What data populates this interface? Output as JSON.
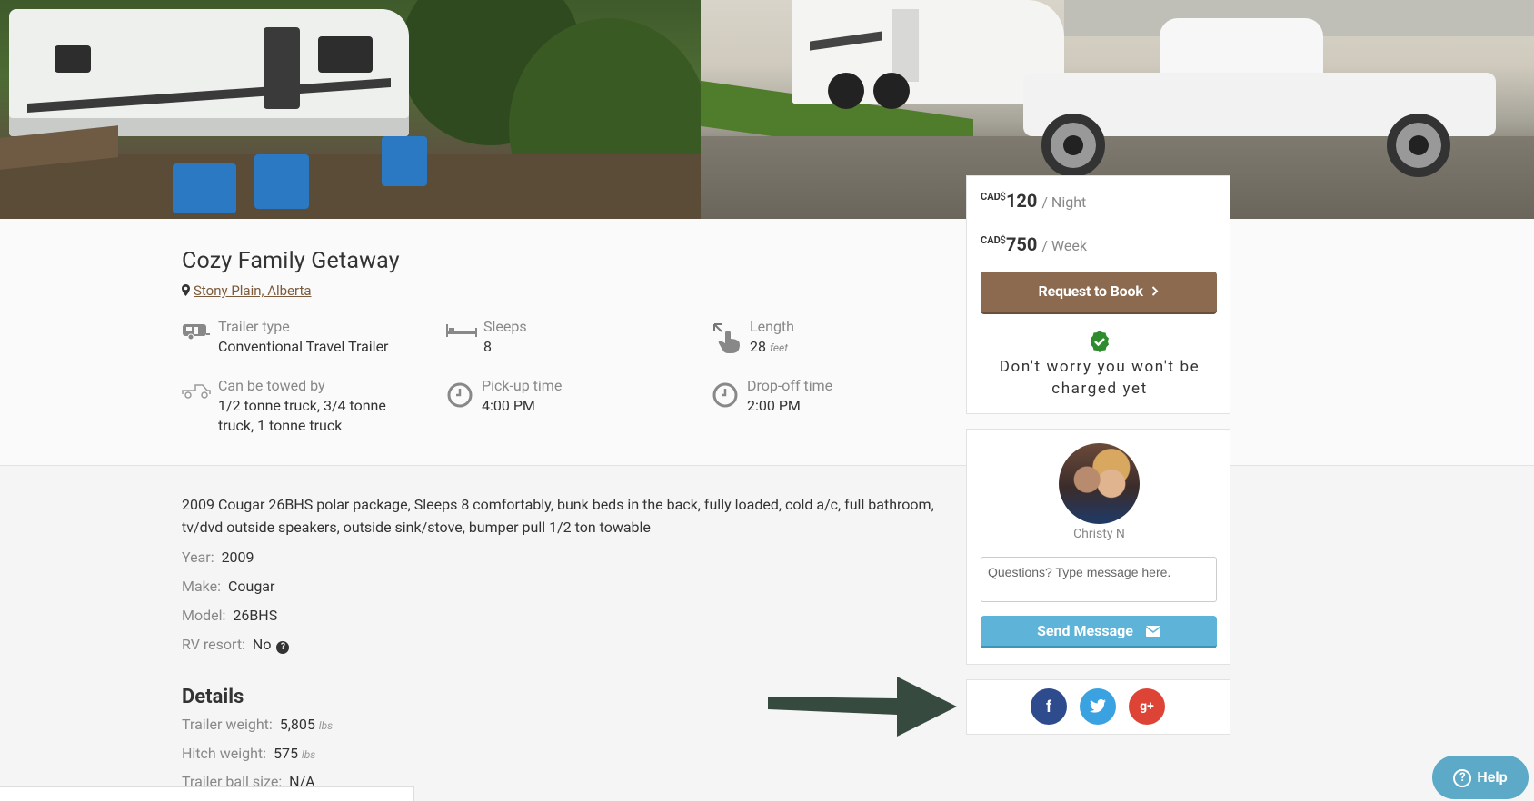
{
  "listing": {
    "title": "Cozy Family Getaway",
    "location": "Stony Plain, Alberta"
  },
  "features": [
    {
      "label": "Trailer type",
      "value": "Conventional Travel Trailer",
      "icon": "trailer-icon"
    },
    {
      "label": "Sleeps",
      "value": "8",
      "icon": "bed-icon"
    },
    {
      "label": "Length",
      "value": "28",
      "unit": "feet",
      "icon": "measure-hand-icon"
    },
    {
      "label": "Can be towed by",
      "value": "1/2 tonne truck, 3/4 tonne truck, 1 tonne truck",
      "icon": "truck-icon"
    },
    {
      "label": "Pick-up time",
      "value": "4:00 PM",
      "icon": "clock-icon"
    },
    {
      "label": "Drop-off time",
      "value": "2:00 PM",
      "icon": "clock-icon"
    }
  ],
  "description": "2009 Cougar 26BHS polar package, Sleeps 8 comfortably, bunk beds in the back, fully loaded, cold a/c, full bathroom, tv/dvd outside speakers, outside sink/stove, bumper pull 1/2 ton towable",
  "specs": {
    "year": {
      "label": "Year:",
      "value": "2009"
    },
    "make": {
      "label": "Make:",
      "value": "Cougar"
    },
    "model": {
      "label": "Model:",
      "value": "26BHS"
    },
    "rv_resort": {
      "label": "RV resort:",
      "value": "No"
    }
  },
  "details": {
    "heading": "Details",
    "trailer_weight": {
      "label": "Trailer weight:",
      "value": "5,805",
      "unit": "lbs"
    },
    "hitch_weight": {
      "label": "Hitch weight:",
      "value": "575",
      "unit": "lbs"
    },
    "ball_size": {
      "label": "Trailer ball size:",
      "value": "N/A"
    }
  },
  "pricing": {
    "night": {
      "currency": "CAD",
      "symbol": "$",
      "amount": "120",
      "per": "/ Night"
    },
    "week": {
      "currency": "CAD",
      "symbol": "$",
      "amount": "750",
      "per": "/ Week"
    },
    "book_label": "Request to Book",
    "reassurance": "Don't worry you won't be charged yet"
  },
  "owner": {
    "name": "Christy N",
    "message_placeholder": "Questions? Type message here.",
    "send_label": "Send Message"
  },
  "share": {
    "facebook": "f",
    "google": "g+"
  },
  "help": {
    "label": "Help"
  },
  "colors": {
    "brand_brown": "#8b6a4f",
    "send_blue": "#5db4d8",
    "check_green": "#2e8b2e",
    "facebook": "#2e4b8d",
    "twitter": "#3aa2e0",
    "google": "#dd4436",
    "arrow": "#364a40"
  }
}
